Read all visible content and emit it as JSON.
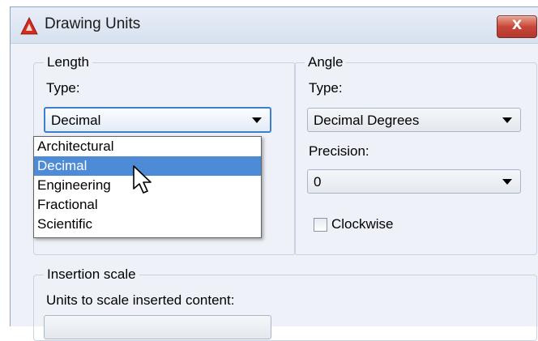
{
  "window": {
    "title": "Drawing Units",
    "close_label": "X"
  },
  "length": {
    "group_label": "Length",
    "type_label": "Type:",
    "type_value": "Decimal",
    "options": [
      "Architectural",
      "Decimal",
      "Engineering",
      "Fractional",
      "Scientific"
    ],
    "highlighted_option": "Decimal"
  },
  "angle": {
    "group_label": "Angle",
    "type_label": "Type:",
    "type_value": "Decimal Degrees",
    "precision_label": "Precision:",
    "precision_value": "0",
    "clockwise_label": "Clockwise",
    "clockwise_checked": false
  },
  "insertion": {
    "group_label": "Insertion scale",
    "units_label": "Units to scale inserted content:"
  },
  "colors": {
    "highlight": "#4d8bd6",
    "focus_border": "#3b7fcf",
    "close": "#c9473a",
    "app_icon": "#d62b1f"
  }
}
